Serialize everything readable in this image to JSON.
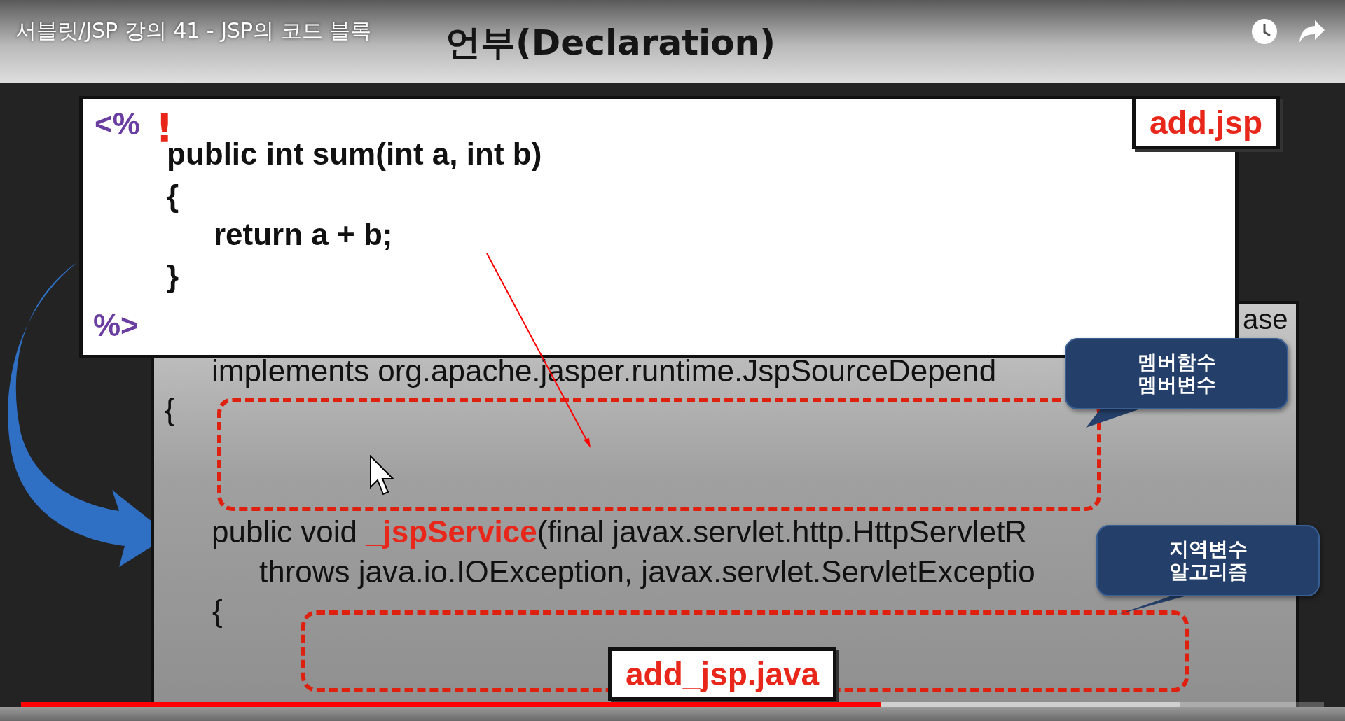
{
  "player": {
    "title": "서블릿/JSP 강의 41 - JSP의 코드 블록",
    "progress": {
      "level": 0.66
    }
  },
  "slide": {
    "title": "언부(Declaration)",
    "jsp_code": {
      "file_label": "add.jsp",
      "open_tag": "<%",
      "declaration_mark": "!",
      "close_tag": "%>",
      "lines": [
        "public int sum(int a, int b)",
        "{",
        "return a + b;",
        "}"
      ]
    },
    "java_code": {
      "file_label": "add_jsp.java",
      "partial_word": "ase",
      "lines": [
        [
          {
            "text": "implements org.apache.jasper.runtime.JspSourceDepend",
            "highlight": false
          }
        ],
        [
          {
            "text": "{",
            "highlight": false
          }
        ],
        [
          {
            "text": "public void ",
            "highlight": false
          },
          {
            "text": "_jspService",
            "highlight": true
          },
          {
            "text": "(final javax.servlet.http.HttpServletR",
            "highlight": false
          }
        ],
        [
          {
            "text": "throws java.io.IOException, javax.servlet.ServletExceptio",
            "highlight": false
          }
        ],
        [
          {
            "text": "{",
            "highlight": false
          }
        ]
      ]
    },
    "callouts": [
      {
        "lines": [
          "멤버함수",
          "멤버변수"
        ]
      },
      {
        "lines": [
          "지역변수",
          "알고리즘"
        ]
      }
    ]
  }
}
